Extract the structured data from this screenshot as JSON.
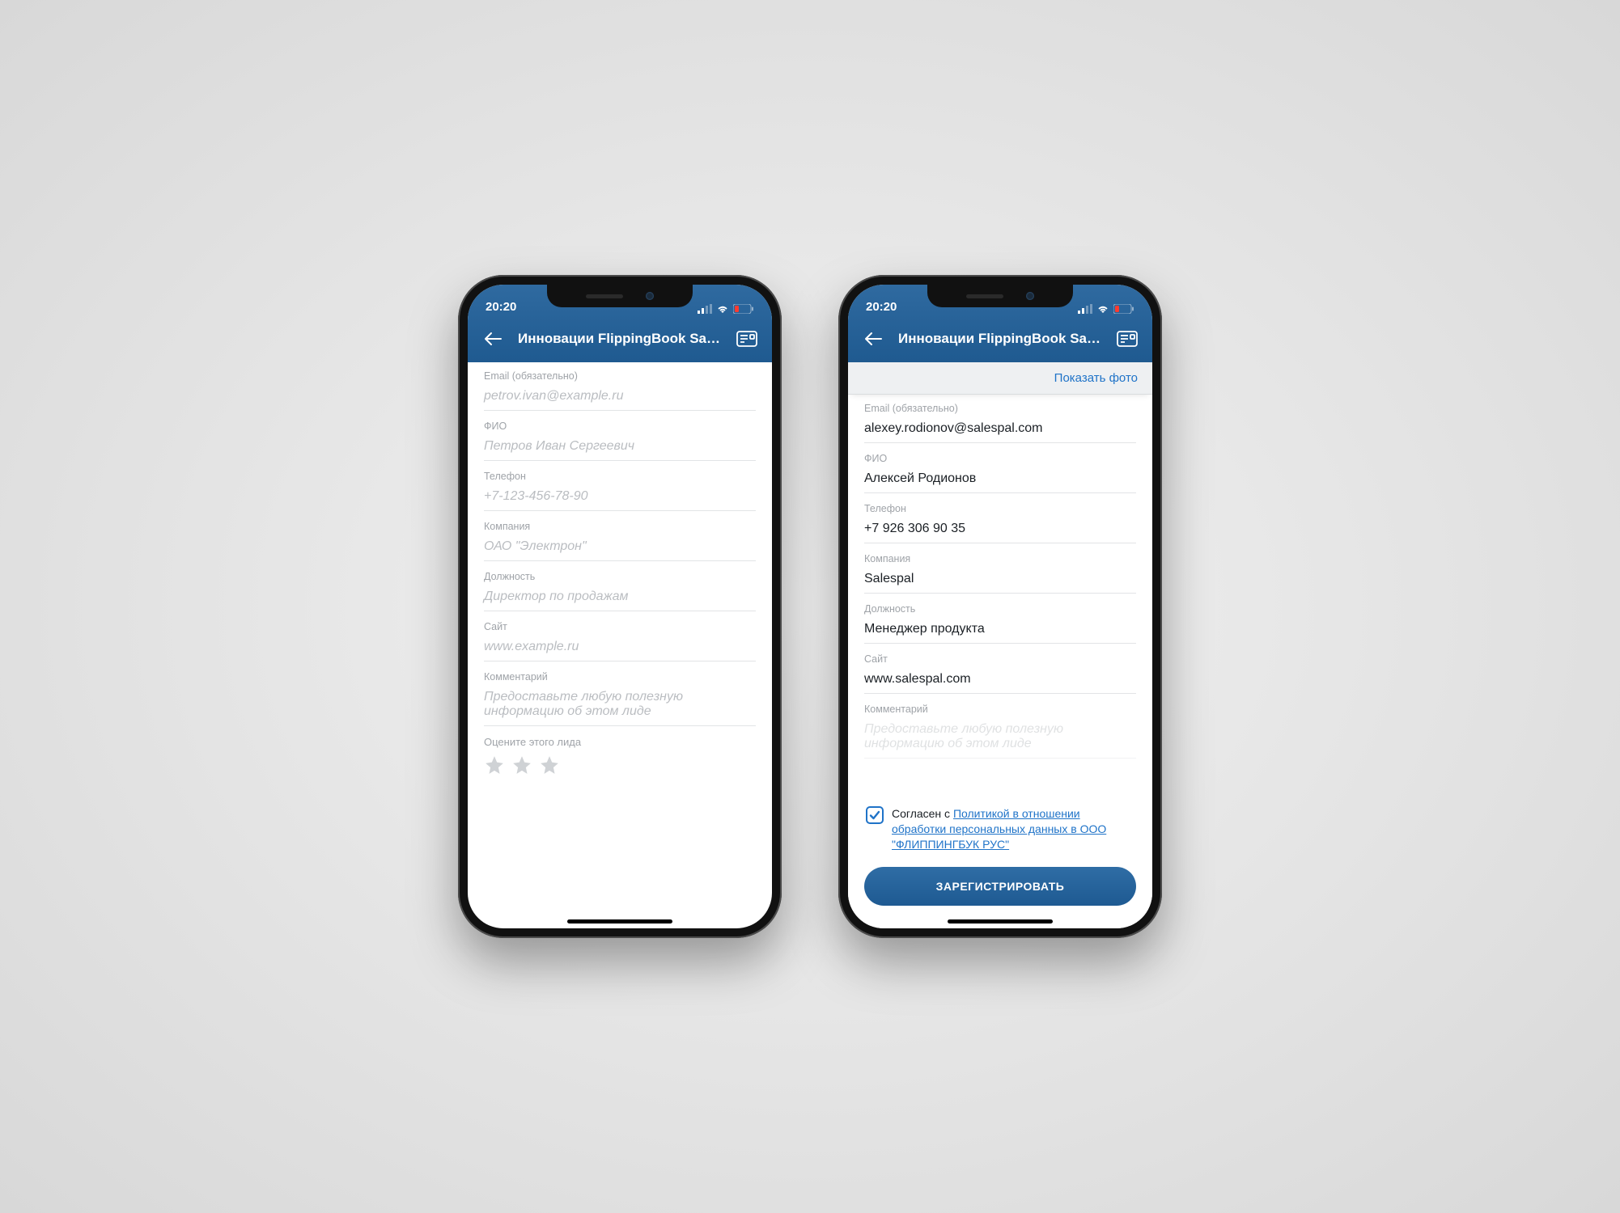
{
  "status": {
    "time": "20:20"
  },
  "header": {
    "title": "Инновации FlippingBook Salespal"
  },
  "actions": {
    "show_photo": "Показать фото"
  },
  "fields": {
    "email": {
      "label": "Email (обязательно)",
      "placeholder": "petrov.ivan@example.ru"
    },
    "name": {
      "label": "ФИО",
      "placeholder": "Петров Иван Сергеевич"
    },
    "phone": {
      "label": "Телефон",
      "placeholder": "+7-123-456-78-90"
    },
    "company": {
      "label": "Компания",
      "placeholder": "ОАО \"Электрон\""
    },
    "role": {
      "label": "Должность",
      "placeholder": "Директор по продажам"
    },
    "site": {
      "label": "Сайт",
      "placeholder": "www.example.ru"
    },
    "comment": {
      "label": "Комментарий",
      "placeholder": "Предоставьте любую полезную\nинформацию об этом лиде"
    }
  },
  "rating": {
    "label": "Оцените этого лида"
  },
  "values": {
    "email": "alexey.rodionov@salespal.com",
    "name": "Алексей Родионов",
    "phone": "+7 926 306 90 35",
    "company": "Salespal",
    "role": "Менеджер продукта",
    "site": "www.salespal.com"
  },
  "consent": {
    "prefix": "Согласен с ",
    "link": "Политикой в отношении обработки персональных данных в ООО \"ФЛИППИНГБУК РУС\"",
    "checked": true
  },
  "submit": {
    "label": "ЗАРЕГИСТРИРОВАТЬ"
  }
}
